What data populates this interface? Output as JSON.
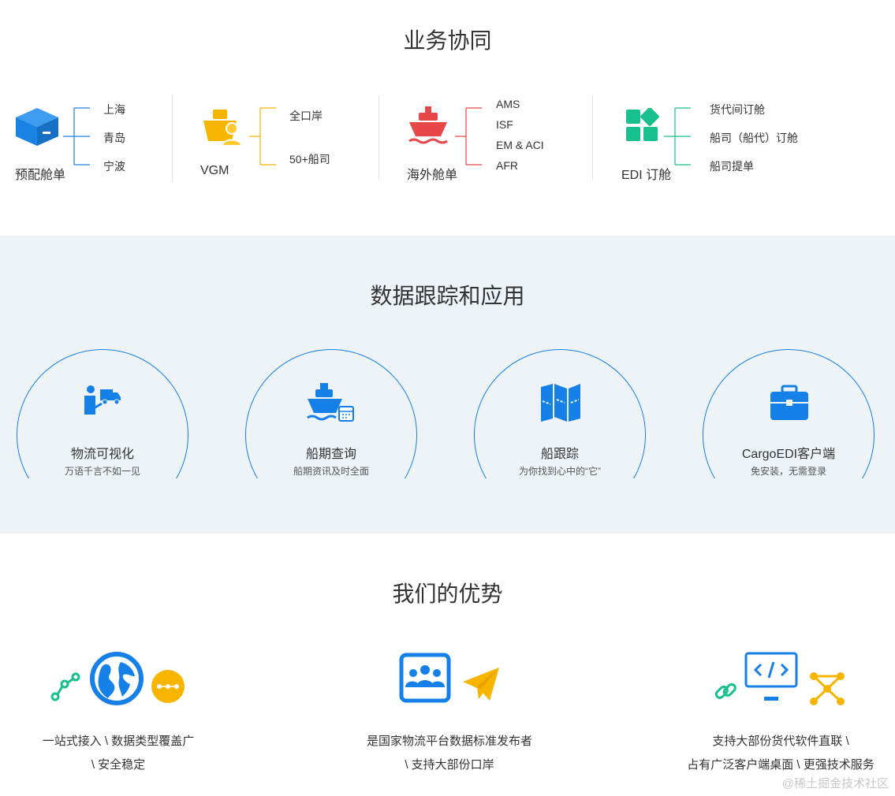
{
  "section_business": {
    "title": "业务协同",
    "groups": [
      {
        "name": "预配舱单",
        "icon": "box-icon",
        "items": [
          "上海",
          "青岛",
          "宁波"
        ]
      },
      {
        "name": "VGM",
        "icon": "ship-person-icon",
        "items": [
          "全口岸",
          "50+船司"
        ]
      },
      {
        "name": "海外舱单",
        "icon": "ship-waves-icon",
        "items": [
          "AMS",
          "ISF",
          "EM & ACI",
          "AFR"
        ]
      },
      {
        "name": "EDI 订舱",
        "icon": "apps-grid-icon",
        "items": [
          "货代间订舱",
          "船司（船代）订舱",
          "船司提单"
        ]
      }
    ],
    "colors": {
      "box": "#1a82e2",
      "vgm": "#f7b500",
      "overseas": "#e84747",
      "edi": "#17c08d"
    }
  },
  "section_data": {
    "title": "数据跟踪和应用",
    "cards": [
      {
        "title": "物流可视化",
        "subtitle": "万语千言不如一见",
        "icon": "logistics-person-truck-icon"
      },
      {
        "title": "船期查询",
        "subtitle": "船期资讯及时全面",
        "icon": "ship-calendar-icon"
      },
      {
        "title": "船跟踪",
        "subtitle": "为你找到心中的“它”",
        "icon": "folded-map-icon"
      },
      {
        "title": "CargoEDI客户端",
        "subtitle": "免安装，无需登录",
        "icon": "briefcase-icon"
      }
    ],
    "colors": {
      "accent": "#1580e8",
      "band": "#eef3f8"
    }
  },
  "section_advantages": {
    "title": "我们的优势",
    "items": [
      {
        "lines": [
          "一站式接入 \\ 数据类型覆盖广",
          "\\ 安全稳定"
        ],
        "icons": [
          "node-path-icon",
          "globe-icon",
          "dots-coin-icon"
        ]
      },
      {
        "lines": [
          "是国家物流平台数据标准发布者",
          "\\ 支持大部份口岸"
        ],
        "icons": [
          "team-board-icon",
          "paper-plane-icon"
        ]
      },
      {
        "lines": [
          "支持大部份货代软件直联 \\",
          "占有广泛客户端桌面 \\ 更强技术服务"
        ],
        "icons": [
          "link-icon",
          "code-monitor-icon",
          "network-nodes-icon"
        ]
      }
    ]
  },
  "watermark": "@稀土掘金技术社区"
}
